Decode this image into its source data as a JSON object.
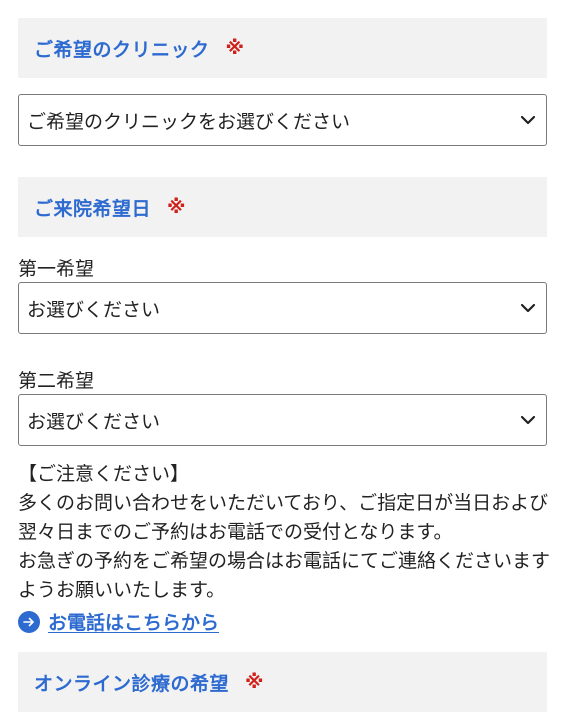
{
  "clinic_section": {
    "title": "ご希望のクリニック",
    "required": "※",
    "select_value": "ご希望のクリニックをお選びください"
  },
  "visit_section": {
    "title": "ご来院希望日",
    "required": "※",
    "first_choice": {
      "label": "第一希望",
      "select_value": "お選びください"
    },
    "second_choice": {
      "label": "第二希望",
      "select_value": "お選びください"
    }
  },
  "notice": {
    "heading": "【ご注意ください】",
    "paragraph1": "多くのお問い合わせをいただいており、ご指定日が当日および翌々日までのご予約はお電話での受付となります。",
    "paragraph2": "お急ぎの予約をご希望の場合はお電話にてご連絡くださいますようお願いいたします。"
  },
  "phone_link": {
    "label": "お電話はこちらから",
    "icon": "arrow-right-circle-icon"
  },
  "online_section": {
    "title": "オンライン診療の希望",
    "required": "※"
  },
  "colors": {
    "accent": "#2e6bd0",
    "required": "#d0201a",
    "header_bg": "#f2f2f2",
    "border": "#7a7a7a"
  }
}
